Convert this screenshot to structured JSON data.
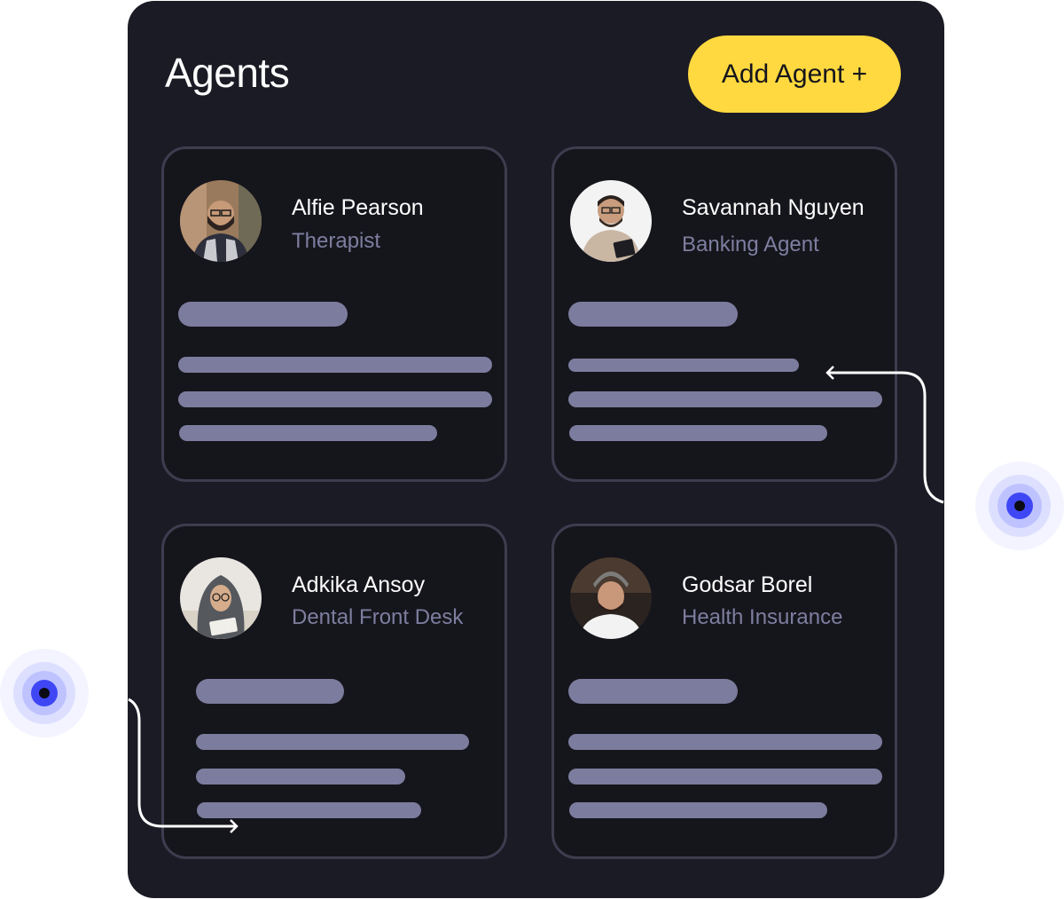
{
  "header": {
    "title": "Agents",
    "add_button_label": "Add Agent +"
  },
  "agents": [
    {
      "name": "Alfie Pearson",
      "role": "Therapist"
    },
    {
      "name": "Savannah Nguyen",
      "role": "Banking Agent"
    },
    {
      "name": "Adkika Ansoy",
      "role": "Dental Front Desk"
    },
    {
      "name": "Godsar Borel",
      "role": "Health Insurance"
    }
  ],
  "colors": {
    "panel_bg": "#1b1b26",
    "card_bg": "#15151c",
    "card_border": "#3e3d4f",
    "accent_button": "#ffd93f",
    "placeholder_bar": "#7c7c9e",
    "role_text": "#7e7ea0",
    "pulse_dot": "#3f47f5"
  }
}
